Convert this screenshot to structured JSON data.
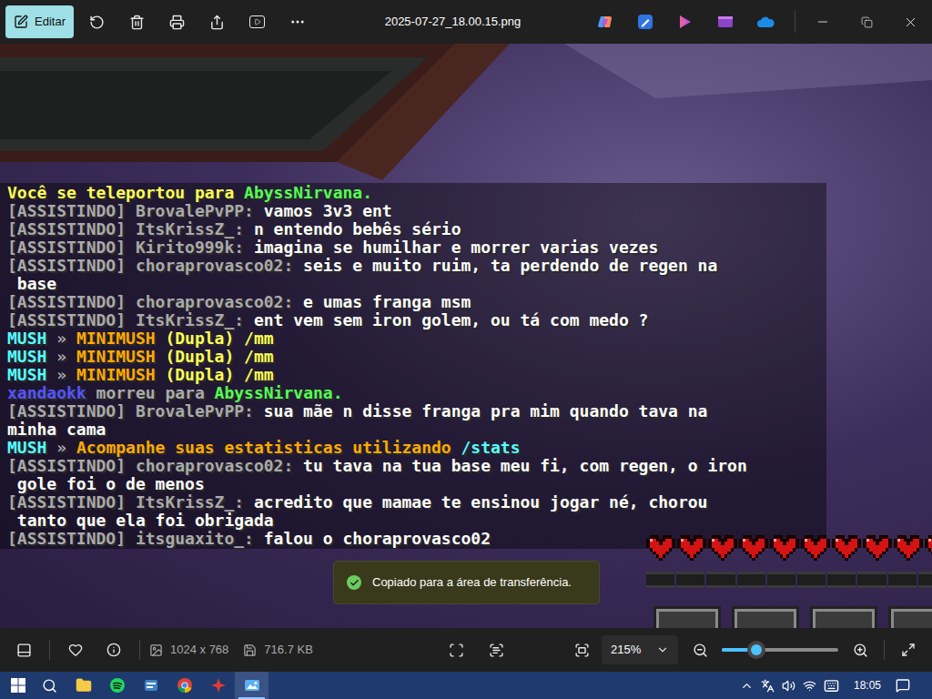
{
  "window": {
    "title": "2025-07-27_18.00.15.png"
  },
  "toolbar": {
    "edit_button": "Editar"
  },
  "game": {
    "chat": [
      {
        "segments": [
          {
            "text": "Você se teleportou para ",
            "color": "#ffff55"
          },
          {
            "text": "AbyssNirvana.",
            "color": "#55ff55"
          }
        ]
      },
      {
        "segments": [
          {
            "text": "[ASSISTINDO] BrovalePvPP: ",
            "color": "#aaaaaa"
          },
          {
            "text": "vamos 3v3 ent",
            "color": "#ffffff"
          }
        ]
      },
      {
        "segments": [
          {
            "text": "[ASSISTINDO] ItsKrissZ_: ",
            "color": "#aaaaaa"
          },
          {
            "text": "n entendo bebês sério",
            "color": "#ffffff"
          }
        ]
      },
      {
        "segments": [
          {
            "text": "[ASSISTINDO] Kirito999k: ",
            "color": "#aaaaaa"
          },
          {
            "text": "imagina se humilhar e morrer varias vezes",
            "color": "#ffffff"
          }
        ]
      },
      {
        "segments": [
          {
            "text": "[ASSISTINDO] choraprovasco02: ",
            "color": "#aaaaaa"
          },
          {
            "text": "seis e muito ruim, ta perdendo de regen na",
            "color": "#ffffff"
          }
        ]
      },
      {
        "segments": [
          {
            "text": " base",
            "color": "#ffffff"
          }
        ]
      },
      {
        "segments": [
          {
            "text": "[ASSISTINDO] choraprovasco02: ",
            "color": "#aaaaaa"
          },
          {
            "text": "e umas franga msm",
            "color": "#ffffff"
          }
        ]
      },
      {
        "segments": [
          {
            "text": "[ASSISTINDO] ItsKrissZ_: ",
            "color": "#aaaaaa"
          },
          {
            "text": "ent vem sem iron golem, ou tá com medo ?",
            "color": "#ffffff"
          }
        ]
      },
      {
        "segments": [
          {
            "text": "MUSH",
            "color": "#55ffff"
          },
          {
            "text": " » ",
            "color": "#aaaaaa"
          },
          {
            "text": "MINIMUSH",
            "color": "#ffaa00"
          },
          {
            "text": " (Dupla) /mm",
            "color": "#ffff55"
          }
        ]
      },
      {
        "segments": [
          {
            "text": "MUSH",
            "color": "#55ffff"
          },
          {
            "text": " » ",
            "color": "#aaaaaa"
          },
          {
            "text": "MINIMUSH",
            "color": "#ffaa00"
          },
          {
            "text": " (Dupla) /mm",
            "color": "#ffff55"
          }
        ]
      },
      {
        "segments": [
          {
            "text": "MUSH",
            "color": "#55ffff"
          },
          {
            "text": " » ",
            "color": "#aaaaaa"
          },
          {
            "text": "MINIMUSH",
            "color": "#ffaa00"
          },
          {
            "text": " (Dupla) /mm",
            "color": "#ffff55"
          }
        ]
      },
      {
        "segments": [
          {
            "text": "xandaokk",
            "color": "#5555ff"
          },
          {
            "text": " morreu para ",
            "color": "#aaaaaa"
          },
          {
            "text": "AbyssNirvana.",
            "color": "#55ff55"
          }
        ]
      },
      {
        "segments": [
          {
            "text": "[ASSISTINDO] BrovalePvPP: ",
            "color": "#aaaaaa"
          },
          {
            "text": "sua mãe n disse franga pra mim quando tava na",
            "color": "#ffffff"
          }
        ]
      },
      {
        "segments": [
          {
            "text": "minha cama",
            "color": "#ffffff"
          }
        ]
      },
      {
        "segments": [
          {
            "text": "MUSH",
            "color": "#55ffff"
          },
          {
            "text": " » ",
            "color": "#aaaaaa"
          },
          {
            "text": "Acompanhe suas estatisticas utilizando ",
            "color": "#ffaa00"
          },
          {
            "text": "/stats",
            "color": "#55ffff"
          }
        ]
      },
      {
        "segments": [
          {
            "text": "[ASSISTINDO] choraprovasco02: ",
            "color": "#aaaaaa"
          },
          {
            "text": "tu tava na tua base meu fi, com regen, o iron",
            "color": "#ffffff"
          }
        ]
      },
      {
        "segments": [
          {
            "text": " gole foi o de menos",
            "color": "#ffffff"
          }
        ]
      },
      {
        "segments": [
          {
            "text": "[ASSISTINDO] ItsKrissZ_: ",
            "color": "#aaaaaa"
          },
          {
            "text": "acredito que mamae te ensinou jogar né, chorou",
            "color": "#ffffff"
          }
        ]
      },
      {
        "segments": [
          {
            "text": " tanto que ela foi obrigada",
            "color": "#ffffff"
          }
        ]
      },
      {
        "segments": [
          {
            "text": "[ASSISTINDO] itsguaxito_: ",
            "color": "#aaaaaa"
          },
          {
            "text": "falou o choraprovasco02",
            "color": "#ffffff"
          }
        ]
      }
    ],
    "hearts": [
      {
        "filled": true
      },
      {
        "filled": true
      },
      {
        "filled": true
      },
      {
        "filled": true
      },
      {
        "filled": true
      },
      {
        "filled": true
      },
      {
        "filled": true
      },
      {
        "filled": true
      },
      {
        "filled": true
      },
      {
        "filled": true
      }
    ]
  },
  "toast": {
    "text": "Copiado para a área de transferência."
  },
  "bottom_bar": {
    "dimensions": "1024 x 768",
    "size": "716.7 KB",
    "zoom": "215%",
    "zoom_level": 0.3
  },
  "taskbar": {
    "apps": [
      {
        "kind": "explorer",
        "selected": false
      },
      {
        "kind": "spotify",
        "selected": false
      },
      {
        "kind": "notes",
        "selected": false
      },
      {
        "kind": "chrome",
        "selected": false
      },
      {
        "kind": "red",
        "selected": false
      },
      {
        "kind": "photos",
        "selected": true
      }
    ],
    "time": "18:05"
  }
}
